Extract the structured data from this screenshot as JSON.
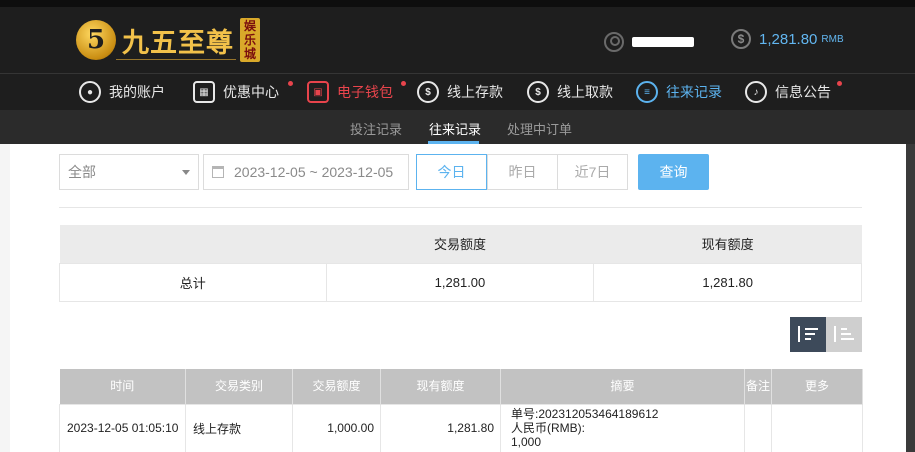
{
  "header": {
    "logo_mark": "5",
    "logo_text": "九五至尊",
    "logo_sub": "娱乐城",
    "balance_amount": "1,281.80",
    "balance_unit": "RMB",
    "balance_icon": "dollar-coin-icon",
    "user_icon": "user-icon"
  },
  "nav": [
    {
      "label": "我的账户",
      "icon": "user-icon",
      "state": "normal",
      "dot": false
    },
    {
      "label": "优惠中心",
      "icon": "gift-icon",
      "state": "normal",
      "dot": true
    },
    {
      "label": "电子钱包",
      "icon": "wallet-icon",
      "state": "wallet",
      "dot": true
    },
    {
      "label": "线上存款",
      "icon": "deposit-icon",
      "state": "normal",
      "dot": false
    },
    {
      "label": "线上取款",
      "icon": "withdraw-icon",
      "state": "normal",
      "dot": false
    },
    {
      "label": "往来记录",
      "icon": "records-icon",
      "state": "active",
      "dot": false
    },
    {
      "label": "信息公告",
      "icon": "bell-icon",
      "state": "normal",
      "dot": true
    }
  ],
  "subnav": {
    "items": [
      "投注记录",
      "往来记录",
      "处理中订单"
    ],
    "active": "往来记录"
  },
  "filters": {
    "type_select": "全部",
    "date_range": "2023-12-05 ~ 2023-12-05",
    "quick": [
      "今日",
      "昨日",
      "近7日"
    ],
    "quick_active": "今日",
    "query_label": "查询"
  },
  "summary": {
    "headers": [
      "",
      "交易额度",
      "现有额度"
    ],
    "row": [
      "总计",
      "1,281.00",
      "1,281.80"
    ]
  },
  "records": {
    "headers": [
      "时间",
      "交易类别",
      "交易额度",
      "现有额度",
      "摘要",
      "备注",
      "更多"
    ],
    "rows": [
      {
        "time": "2023-12-05 01:05:10",
        "type": "线上存款",
        "amount": "1,000.00",
        "balance": "1,281.80",
        "summary_line1": "单号:202312053464189612",
        "summary_line2": "人民币(RMB):",
        "summary_line3": "1,000",
        "remark": "",
        "more": ""
      }
    ]
  },
  "colors": {
    "accent": "#5cb3ef",
    "wallet_red": "#e8444c",
    "header_bg": "#1e1e1e",
    "gold": "#f2c14a"
  }
}
